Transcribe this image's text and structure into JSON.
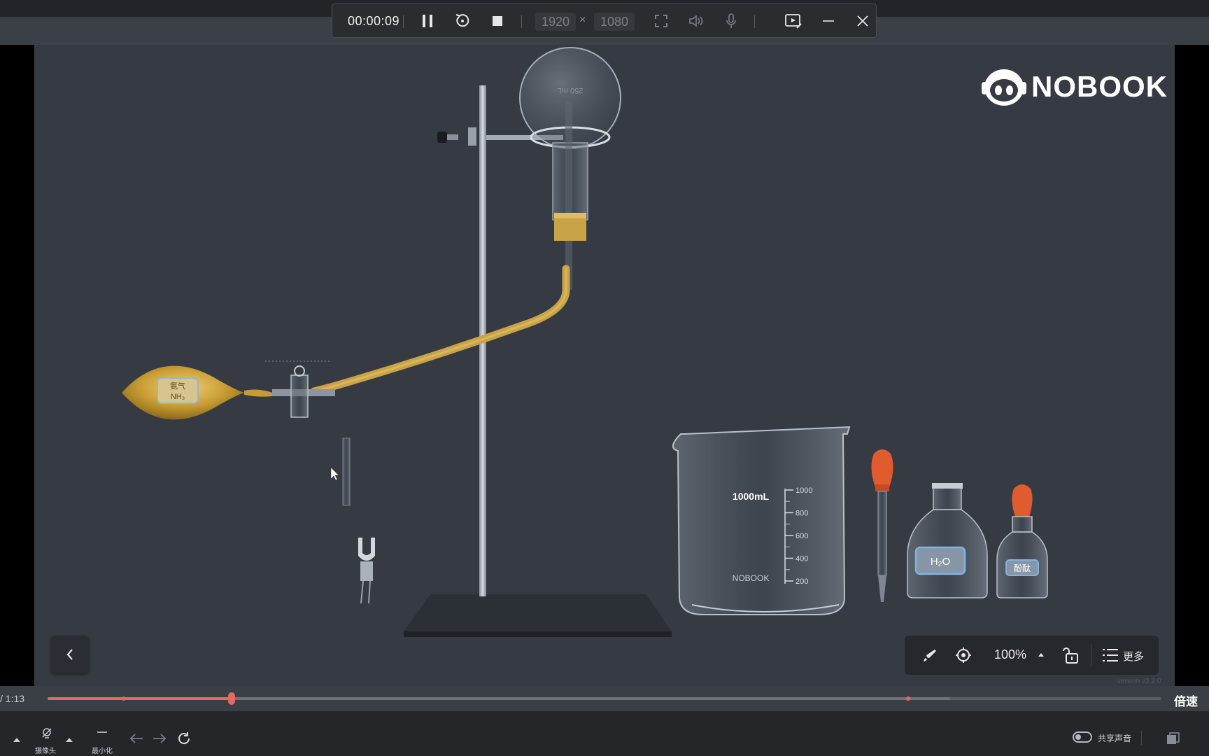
{
  "recorder": {
    "elapsed": "00:00:09",
    "width_value": "1920",
    "height_value": "1080",
    "times_sign": "×"
  },
  "brand": {
    "logo_text": "NOBOOK",
    "version": "version v2.2.0"
  },
  "apparatus": {
    "flask_volume": "250 mL",
    "gas_bag_label_cn": "氨气",
    "gas_bag_label_formula": "NH₃",
    "beaker_capacity": "1000mL",
    "beaker_brand": "NOBOOK",
    "beaker_ticks": [
      "1000",
      "800",
      "600",
      "400",
      "200"
    ],
    "water_bottle_label": "H₂O",
    "indicator_bottle_label": "酚酞"
  },
  "toolbar": {
    "zoom": "100%",
    "more_label": "更多"
  },
  "playback": {
    "duration": "/ 1:13",
    "progress": 0.165,
    "buffered": 0.81,
    "speed_label": "倍速"
  },
  "bottom": {
    "camera_label": "摄像头",
    "minimize_label": "最小化",
    "share_sound_label": "共享声音"
  },
  "colors": {
    "accent": "#e46a60",
    "gold_tube": "#c9a347",
    "stage_bg": "#363b43"
  }
}
